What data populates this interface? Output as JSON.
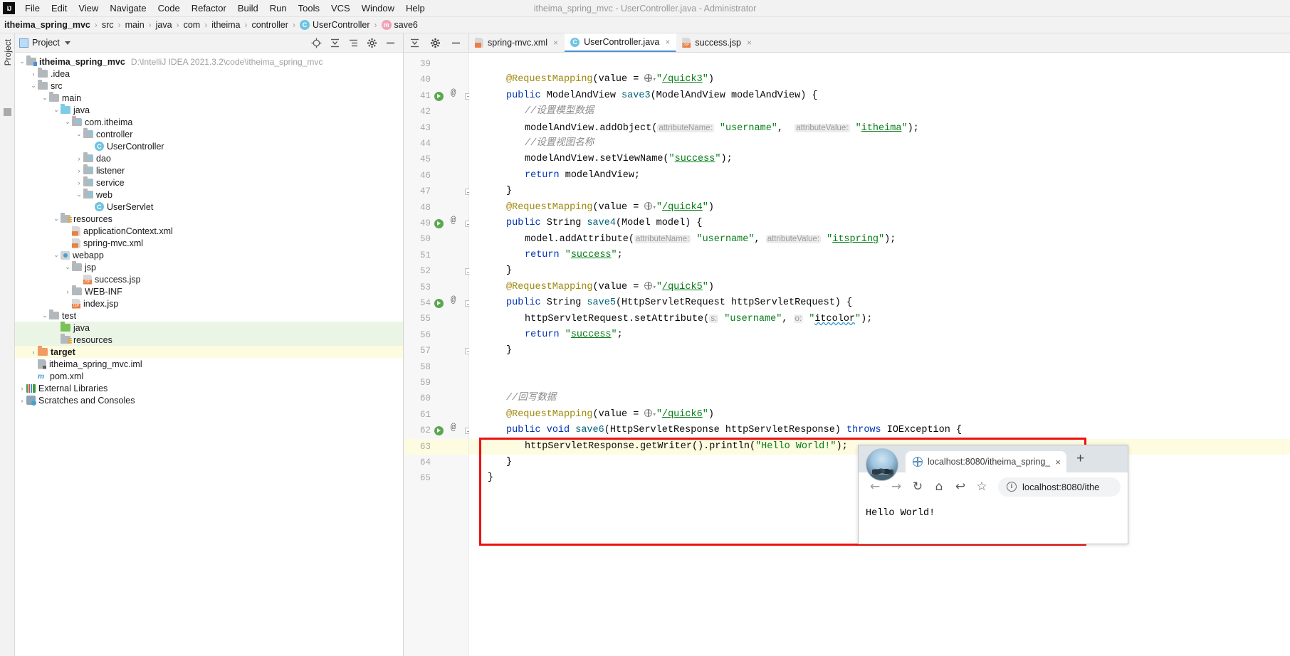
{
  "menubar": {
    "logo": "IJ",
    "items": [
      "File",
      "Edit",
      "View",
      "Navigate",
      "Code",
      "Refactor",
      "Build",
      "Run",
      "Tools",
      "VCS",
      "Window",
      "Help"
    ],
    "window_title": "itheima_spring_mvc - UserController.java - Administrator"
  },
  "breadcrumb": {
    "items": [
      {
        "label": "itheima_spring_mvc",
        "icon": "none",
        "bold": true
      },
      {
        "label": "src",
        "icon": "none",
        "bold": false
      },
      {
        "label": "main",
        "icon": "none",
        "bold": false
      },
      {
        "label": "java",
        "icon": "none",
        "bold": false
      },
      {
        "label": "com",
        "icon": "none",
        "bold": false
      },
      {
        "label": "itheima",
        "icon": "none",
        "bold": false
      },
      {
        "label": "controller",
        "icon": "none",
        "bold": false
      },
      {
        "label": "UserController",
        "icon": "class-icon",
        "bold": false
      },
      {
        "label": "save6",
        "icon": "method-icon",
        "bold": false
      }
    ],
    "separator": "›"
  },
  "left_strip": {
    "label": "Project"
  },
  "project_panel": {
    "title": "Project",
    "actions": [
      "locate-icon",
      "collapse-all-icon",
      "expand-icon",
      "settings-icon",
      "hide-icon"
    ],
    "tree": [
      {
        "indent": 0,
        "arrow": "⌄",
        "icon": "module-folder",
        "label": "itheima_spring_mvc",
        "bold": true,
        "path": "D:\\IntelliJ IDEA 2021.3.2\\code\\itheima_spring_mvc",
        "hl": ""
      },
      {
        "indent": 1,
        "arrow": "›",
        "icon": "folder",
        "label": ".idea",
        "bold": false,
        "path": "",
        "hl": ""
      },
      {
        "indent": 1,
        "arrow": "⌄",
        "icon": "folder",
        "label": "src",
        "bold": false,
        "path": "",
        "hl": ""
      },
      {
        "indent": 2,
        "arrow": "⌄",
        "icon": "folder",
        "label": "main",
        "bold": false,
        "path": "",
        "hl": ""
      },
      {
        "indent": 3,
        "arrow": "⌄",
        "icon": "source-folder",
        "label": "java",
        "bold": false,
        "path": "",
        "hl": ""
      },
      {
        "indent": 4,
        "arrow": "⌄",
        "icon": "package-folder",
        "label": "com.itheima",
        "bold": false,
        "path": "",
        "hl": ""
      },
      {
        "indent": 5,
        "arrow": "⌄",
        "icon": "package-folder",
        "label": "controller",
        "bold": false,
        "path": "",
        "hl": ""
      },
      {
        "indent": 6,
        "arrow": "",
        "icon": "class-icon",
        "label": "UserController",
        "bold": false,
        "path": "",
        "hl": ""
      },
      {
        "indent": 5,
        "arrow": "›",
        "icon": "package-folder",
        "label": "dao",
        "bold": false,
        "path": "",
        "hl": ""
      },
      {
        "indent": 5,
        "arrow": "›",
        "icon": "package-folder",
        "label": "listener",
        "bold": false,
        "path": "",
        "hl": ""
      },
      {
        "indent": 5,
        "arrow": "›",
        "icon": "package-folder",
        "label": "service",
        "bold": false,
        "path": "",
        "hl": ""
      },
      {
        "indent": 5,
        "arrow": "⌄",
        "icon": "package-folder",
        "label": "web",
        "bold": false,
        "path": "",
        "hl": ""
      },
      {
        "indent": 6,
        "arrow": "",
        "icon": "class-icon",
        "label": "UserServlet",
        "bold": false,
        "path": "",
        "hl": ""
      },
      {
        "indent": 3,
        "arrow": "⌄",
        "icon": "resource-folder",
        "label": "resources",
        "bold": false,
        "path": "",
        "hl": ""
      },
      {
        "indent": 4,
        "arrow": "",
        "icon": "xml-icon",
        "label": "applicationContext.xml",
        "bold": false,
        "path": "",
        "hl": ""
      },
      {
        "indent": 4,
        "arrow": "",
        "icon": "xml-icon",
        "label": "spring-mvc.xml",
        "bold": false,
        "path": "",
        "hl": ""
      },
      {
        "indent": 3,
        "arrow": "⌄",
        "icon": "webapp-icon",
        "label": "webapp",
        "bold": false,
        "path": "",
        "hl": ""
      },
      {
        "indent": 4,
        "arrow": "⌄",
        "icon": "folder",
        "label": "jsp",
        "bold": false,
        "path": "",
        "hl": ""
      },
      {
        "indent": 5,
        "arrow": "",
        "icon": "jsp-icon",
        "label": "success.jsp",
        "bold": false,
        "path": "",
        "hl": ""
      },
      {
        "indent": 4,
        "arrow": "›",
        "icon": "folder",
        "label": "WEB-INF",
        "bold": false,
        "path": "",
        "hl": ""
      },
      {
        "indent": 4,
        "arrow": "",
        "icon": "jsp-icon",
        "label": "index.jsp",
        "bold": false,
        "path": "",
        "hl": ""
      },
      {
        "indent": 2,
        "arrow": "⌄",
        "icon": "folder",
        "label": "test",
        "bold": false,
        "path": "",
        "hl": ""
      },
      {
        "indent": 3,
        "arrow": "",
        "icon": "test-source-folder",
        "label": "java",
        "bold": false,
        "path": "",
        "hl": "green"
      },
      {
        "indent": 3,
        "arrow": "",
        "icon": "test-resource-folder",
        "label": "resources",
        "bold": false,
        "path": "",
        "hl": "green"
      },
      {
        "indent": 1,
        "arrow": "›",
        "icon": "target-folder",
        "label": "target",
        "bold": true,
        "path": "",
        "hl": "yellow"
      },
      {
        "indent": 1,
        "arrow": "",
        "icon": "iml-icon",
        "label": "itheima_spring_mvc.iml",
        "bold": false,
        "path": "",
        "hl": ""
      },
      {
        "indent": 1,
        "arrow": "",
        "icon": "maven-icon",
        "label": "pom.xml",
        "bold": false,
        "path": "",
        "hl": ""
      },
      {
        "indent": 0,
        "arrow": "›",
        "icon": "library-icon",
        "label": "External Libraries",
        "bold": false,
        "path": "",
        "hl": ""
      },
      {
        "indent": 0,
        "arrow": "›",
        "icon": "scratches-icon",
        "label": "Scratches and Consoles",
        "bold": false,
        "path": "",
        "hl": ""
      }
    ]
  },
  "editor": {
    "toolbar_buttons": [
      "expand-all-icon",
      "settings-icon",
      "minimize-icon"
    ],
    "tabs": [
      {
        "label": "spring-mvc.xml",
        "icon": "xml-icon",
        "active": false,
        "close": "×"
      },
      {
        "label": "UserController.java",
        "icon": "class-icon",
        "active": true,
        "close": "×"
      },
      {
        "label": "success.jsp",
        "icon": "jsp-icon",
        "active": false,
        "close": "×"
      }
    ],
    "first_line_number": 39,
    "lines": [
      {
        "n": 39,
        "indent": 0,
        "run": false,
        "at": false,
        "fold": false,
        "hl": "",
        "tokens": []
      },
      {
        "n": 40,
        "indent": 1,
        "run": false,
        "at": false,
        "fold": false,
        "hl": "",
        "tokens": [
          {
            "t": "ann",
            "v": "@RequestMapping"
          },
          {
            "t": "p",
            "v": "(value = "
          },
          {
            "t": "globe",
            "v": ""
          },
          {
            "t": "str",
            "v": "\""
          },
          {
            "t": "ustr",
            "v": "/quick3"
          },
          {
            "t": "str",
            "v": "\""
          },
          {
            "t": "p",
            "v": ")"
          }
        ]
      },
      {
        "n": 41,
        "indent": 1,
        "run": true,
        "at": true,
        "fold": true,
        "hl": "",
        "tokens": [
          {
            "t": "k",
            "v": "public "
          },
          {
            "t": "p",
            "v": "ModelAndView "
          },
          {
            "t": "mname",
            "v": "save3"
          },
          {
            "t": "p",
            "v": "(ModelAndView modelAndView) {"
          }
        ]
      },
      {
        "n": 42,
        "indent": 2,
        "run": false,
        "at": false,
        "fold": false,
        "hl": "",
        "tokens": [
          {
            "t": "cmt",
            "v": "//设置模型数据"
          }
        ]
      },
      {
        "n": 43,
        "indent": 2,
        "run": false,
        "at": false,
        "fold": false,
        "hl": "",
        "tokens": [
          {
            "t": "p",
            "v": "modelAndView.addObject("
          },
          {
            "t": "hint",
            "v": "attributeName:"
          },
          {
            "t": "str",
            "v": " \"username\""
          },
          {
            "t": "p",
            "v": ",  "
          },
          {
            "t": "hint",
            "v": "attributeValue:"
          },
          {
            "t": "str",
            "v": " \""
          },
          {
            "t": "ustr",
            "v": "itheima"
          },
          {
            "t": "str",
            "v": "\""
          },
          {
            "t": "p",
            "v": ");"
          }
        ]
      },
      {
        "n": 44,
        "indent": 2,
        "run": false,
        "at": false,
        "fold": false,
        "hl": "",
        "tokens": [
          {
            "t": "cmt",
            "v": "//设置视图名称"
          }
        ]
      },
      {
        "n": 45,
        "indent": 2,
        "run": false,
        "at": false,
        "fold": false,
        "hl": "",
        "tokens": [
          {
            "t": "p",
            "v": "modelAndView.setViewName("
          },
          {
            "t": "str",
            "v": "\""
          },
          {
            "t": "ustr",
            "v": "success"
          },
          {
            "t": "str",
            "v": "\""
          },
          {
            "t": "p",
            "v": ");"
          }
        ]
      },
      {
        "n": 46,
        "indent": 2,
        "run": false,
        "at": false,
        "fold": false,
        "hl": "",
        "tokens": [
          {
            "t": "k",
            "v": "return "
          },
          {
            "t": "p",
            "v": "modelAndView;"
          }
        ]
      },
      {
        "n": 47,
        "indent": 1,
        "run": false,
        "at": false,
        "fold": true,
        "hl": "",
        "tokens": [
          {
            "t": "p",
            "v": "}"
          }
        ]
      },
      {
        "n": 48,
        "indent": 1,
        "run": false,
        "at": false,
        "fold": false,
        "hl": "",
        "tokens": [
          {
            "t": "ann",
            "v": "@RequestMapping"
          },
          {
            "t": "p",
            "v": "(value = "
          },
          {
            "t": "globe",
            "v": ""
          },
          {
            "t": "str",
            "v": "\""
          },
          {
            "t": "ustr",
            "v": "/quick4"
          },
          {
            "t": "str",
            "v": "\""
          },
          {
            "t": "p",
            "v": ")"
          }
        ]
      },
      {
        "n": 49,
        "indent": 1,
        "run": true,
        "at": true,
        "fold": true,
        "hl": "",
        "tokens": [
          {
            "t": "k",
            "v": "public "
          },
          {
            "t": "p",
            "v": "String "
          },
          {
            "t": "mname",
            "v": "save4"
          },
          {
            "t": "p",
            "v": "(Model model) {"
          }
        ]
      },
      {
        "n": 50,
        "indent": 2,
        "run": false,
        "at": false,
        "fold": false,
        "hl": "",
        "tokens": [
          {
            "t": "p",
            "v": "model.addAttribute("
          },
          {
            "t": "hint",
            "v": "attributeName:"
          },
          {
            "t": "str",
            "v": " \"username\""
          },
          {
            "t": "p",
            "v": ", "
          },
          {
            "t": "hint",
            "v": "attributeValue:"
          },
          {
            "t": "str",
            "v": " \""
          },
          {
            "t": "ustr",
            "v": "itspring"
          },
          {
            "t": "str",
            "v": "\""
          },
          {
            "t": "p",
            "v": ");"
          }
        ]
      },
      {
        "n": 51,
        "indent": 2,
        "run": false,
        "at": false,
        "fold": false,
        "hl": "",
        "tokens": [
          {
            "t": "k",
            "v": "return "
          },
          {
            "t": "str",
            "v": "\""
          },
          {
            "t": "ustr",
            "v": "success"
          },
          {
            "t": "str",
            "v": "\""
          },
          {
            "t": "p",
            "v": ";"
          }
        ]
      },
      {
        "n": 52,
        "indent": 1,
        "run": false,
        "at": false,
        "fold": true,
        "hl": "",
        "tokens": [
          {
            "t": "p",
            "v": "}"
          }
        ]
      },
      {
        "n": 53,
        "indent": 1,
        "run": false,
        "at": false,
        "fold": false,
        "hl": "",
        "tokens": [
          {
            "t": "ann",
            "v": "@RequestMapping"
          },
          {
            "t": "p",
            "v": "(value = "
          },
          {
            "t": "globe",
            "v": ""
          },
          {
            "t": "str",
            "v": "\""
          },
          {
            "t": "ustr",
            "v": "/quick5"
          },
          {
            "t": "str",
            "v": "\""
          },
          {
            "t": "p",
            "v": ")"
          }
        ]
      },
      {
        "n": 54,
        "indent": 1,
        "run": true,
        "at": true,
        "fold": true,
        "hl": "",
        "tokens": [
          {
            "t": "k",
            "v": "public "
          },
          {
            "t": "p",
            "v": "String "
          },
          {
            "t": "mname",
            "v": "save5"
          },
          {
            "t": "p",
            "v": "(HttpServletRequest httpServletRequest) {"
          }
        ]
      },
      {
        "n": 55,
        "indent": 2,
        "run": false,
        "at": false,
        "fold": false,
        "hl": "",
        "tokens": [
          {
            "t": "p",
            "v": "httpServletRequest.setAttribute("
          },
          {
            "t": "hint",
            "v": "s:"
          },
          {
            "t": "str",
            "v": " \"username\""
          },
          {
            "t": "p",
            "v": ", "
          },
          {
            "t": "hint",
            "v": "o:"
          },
          {
            "t": "str",
            "v": " \""
          },
          {
            "t": "squig",
            "v": "itcolor"
          },
          {
            "t": "str",
            "v": "\""
          },
          {
            "t": "p",
            "v": ");"
          }
        ]
      },
      {
        "n": 56,
        "indent": 2,
        "run": false,
        "at": false,
        "fold": false,
        "hl": "",
        "tokens": [
          {
            "t": "k",
            "v": "return "
          },
          {
            "t": "str",
            "v": "\""
          },
          {
            "t": "ustr",
            "v": "success"
          },
          {
            "t": "str",
            "v": "\""
          },
          {
            "t": "p",
            "v": ";"
          }
        ]
      },
      {
        "n": 57,
        "indent": 1,
        "run": false,
        "at": false,
        "fold": true,
        "hl": "",
        "tokens": [
          {
            "t": "p",
            "v": "}"
          }
        ]
      },
      {
        "n": 58,
        "indent": 0,
        "run": false,
        "at": false,
        "fold": false,
        "hl": "",
        "tokens": []
      },
      {
        "n": 59,
        "indent": 0,
        "run": false,
        "at": false,
        "fold": false,
        "hl": "",
        "tokens": []
      },
      {
        "n": 60,
        "indent": 1,
        "run": false,
        "at": false,
        "fold": false,
        "hl": "",
        "tokens": [
          {
            "t": "cmt",
            "v": "//回写数据"
          }
        ]
      },
      {
        "n": 61,
        "indent": 1,
        "run": false,
        "at": false,
        "fold": false,
        "hl": "",
        "tokens": [
          {
            "t": "ann",
            "v": "@RequestMapping"
          },
          {
            "t": "p",
            "v": "(value = "
          },
          {
            "t": "globe",
            "v": ""
          },
          {
            "t": "str",
            "v": "\""
          },
          {
            "t": "ustr",
            "v": "/quick6"
          },
          {
            "t": "str",
            "v": "\""
          },
          {
            "t": "p",
            "v": ")"
          }
        ]
      },
      {
        "n": 62,
        "indent": 1,
        "run": true,
        "at": true,
        "fold": true,
        "hl": "",
        "tokens": [
          {
            "t": "k",
            "v": "public "
          },
          {
            "t": "k",
            "v": "void "
          },
          {
            "t": "mname",
            "v": "save6"
          },
          {
            "t": "p",
            "v": "(HttpServletResponse httpServletResponse) "
          },
          {
            "t": "k",
            "v": "throws "
          },
          {
            "t": "p",
            "v": "IOException {"
          }
        ]
      },
      {
        "n": 63,
        "indent": 2,
        "run": false,
        "at": false,
        "fold": false,
        "hl": "yellow",
        "tokens": [
          {
            "t": "p",
            "v": "httpServletResponse.getWriter().println("
          },
          {
            "t": "str",
            "v": "\"Hello World!\""
          },
          {
            "t": "p",
            "v": ");"
          }
        ]
      },
      {
        "n": 64,
        "indent": 1,
        "run": false,
        "at": false,
        "fold": false,
        "hl": "",
        "tokens": [
          {
            "t": "p",
            "v": "}"
          }
        ]
      },
      {
        "n": 65,
        "indent": 0,
        "run": false,
        "at": false,
        "fold": false,
        "hl": "",
        "tokens": [
          {
            "t": "p",
            "v": "}"
          }
        ]
      }
    ]
  },
  "browser": {
    "tab_title": "localhost:8080/itheima_spring_",
    "tab_close": "×",
    "new_tab": "+",
    "nav": {
      "back": "←",
      "forward": "→",
      "reload": "↻",
      "home": "⌂",
      "history": "↩",
      "bookmark": "☆"
    },
    "url": "localhost:8080/ithe",
    "security_icon": "info-icon",
    "page_content": "Hello World!"
  }
}
